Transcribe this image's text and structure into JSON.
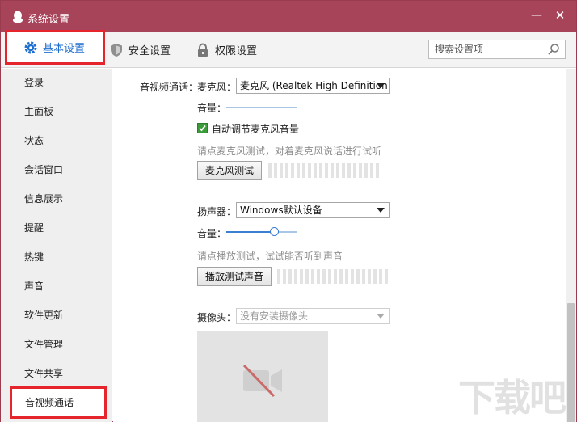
{
  "window": {
    "title": "系统设置"
  },
  "tabs": [
    {
      "label": "基本设置",
      "icon": "gear-icon",
      "active": true
    },
    {
      "label": "安全设置",
      "icon": "shield-icon"
    },
    {
      "label": "权限设置",
      "icon": "lock-icon"
    }
  ],
  "search": {
    "placeholder": "搜索设置项"
  },
  "sidebar": {
    "items": [
      "登录",
      "主面板",
      "状态",
      "会话窗口",
      "信息展示",
      "提醒",
      "热键",
      "声音",
      "软件更新",
      "文件管理",
      "文件共享",
      "音视频通话"
    ],
    "active": "音视频通话"
  },
  "av": {
    "section_label": "音视频通话：",
    "mic_label": "麦克风：",
    "mic_value": "麦克风 (Realtek High Definition ...",
    "mic_volume_label": "音量：",
    "mic_volume": 0.0,
    "auto_adjust_label": "自动调节麦克风音量",
    "auto_adjust_checked": true,
    "mic_hint": "请点麦克风测试，对着麦克风说话进行试听",
    "mic_test_button": "麦克风测试",
    "speaker_label": "扬声器：",
    "speaker_value": "Windows默认设备",
    "speaker_volume_label": "音量：",
    "speaker_volume": 0.68,
    "speaker_hint": "请点播放测试，试试能否听到声音",
    "speaker_test_button": "播放测试声音",
    "camera_label": "摄像头：",
    "camera_value": "没有安装摄像头"
  },
  "watermark": "下载吧",
  "colors": {
    "titlebar": "#a8445a",
    "highlight_border": "#e5242b",
    "active_tab_text": "#1f6fcf",
    "checkbox": "#3b9b3b"
  }
}
